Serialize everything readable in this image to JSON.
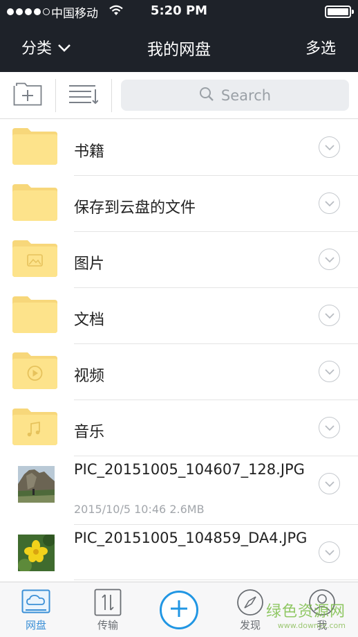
{
  "status_bar": {
    "carrier": "中国移动",
    "time": "5:20 PM"
  },
  "nav": {
    "left_label": "分类",
    "title": "我的网盘",
    "right_label": "多选"
  },
  "search": {
    "placeholder": "Search"
  },
  "folders": [
    {
      "name": "书籍",
      "icon": "folder-icon"
    },
    {
      "name": "保存到云盘的文件",
      "icon": "folder-icon"
    },
    {
      "name": "图片",
      "icon": "image-folder-icon"
    },
    {
      "name": "文档",
      "icon": "folder-icon"
    },
    {
      "name": "视频",
      "icon": "video-folder-icon"
    },
    {
      "name": "音乐",
      "icon": "music-folder-icon"
    }
  ],
  "files": [
    {
      "name": "PIC_20151005_104607_128.JPG",
      "meta": "2015/10/5 10:46 2.6MB"
    },
    {
      "name": "PIC_20151005_104859_DA4.JPG",
      "meta": ""
    }
  ],
  "tabs": [
    {
      "label": "网盘",
      "icon": "cloud-drive-icon",
      "active": true
    },
    {
      "label": "传输",
      "icon": "transfer-icon",
      "active": false
    },
    {
      "label": "发现",
      "icon": "compass-icon",
      "active": false
    },
    {
      "label": "我",
      "icon": "user-icon",
      "active": false
    }
  ],
  "watermark": {
    "line1": "绿色资源网",
    "line2": "www.downcc.com"
  },
  "colors": {
    "header_bg": "#1e2229",
    "folder_yellow": "#fde38b",
    "accent_blue": "#2196e3"
  }
}
